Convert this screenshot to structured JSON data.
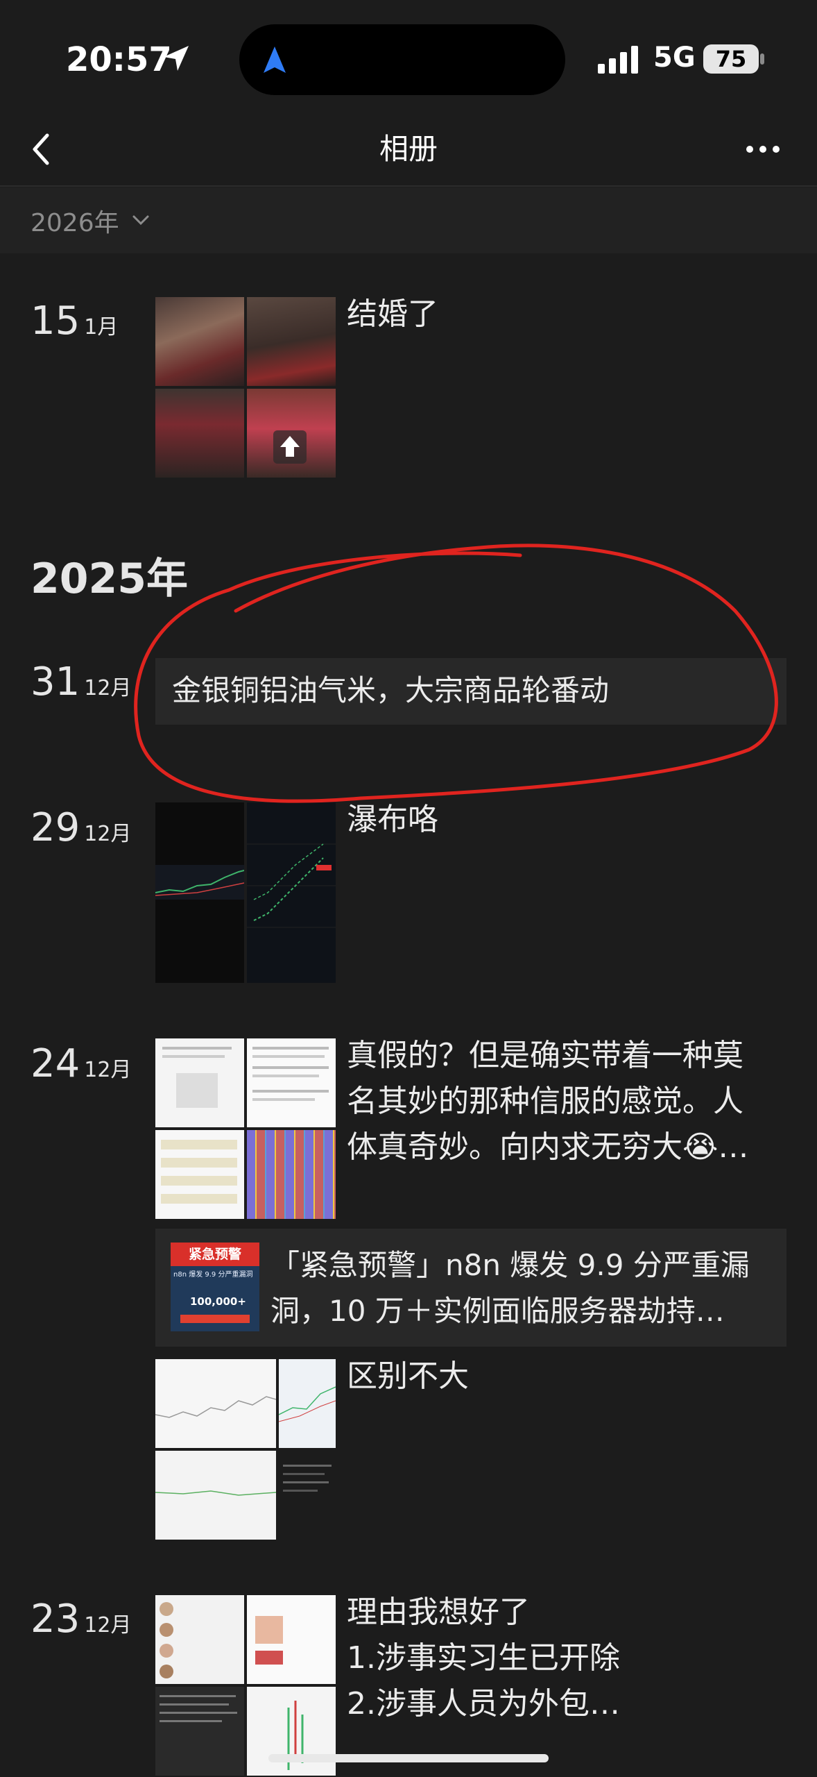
{
  "status_bar": {
    "time": "20:57",
    "network": "5G",
    "battery": "75"
  },
  "nav": {
    "title": "相册"
  },
  "year_filter": {
    "label": "2026年"
  },
  "entries_2026": [
    {
      "day": "15",
      "month": "1月",
      "caption": "结婚了"
    }
  ],
  "year_heading": "2025年",
  "entries_2025": [
    {
      "day": "31",
      "month": "12月",
      "text": "金银铜铝油气米，大宗商品轮番动"
    },
    {
      "day": "29",
      "month": "12月",
      "caption": "瀑布咯"
    },
    {
      "day": "24",
      "month": "12月",
      "caption": "真假的？但是确实带着一种莫名其妙的那种信服的感觉。人体真奇妙。向内求无穷大😭…",
      "link_card": {
        "thumb_badge": "紧急预警",
        "thumb_sub": "n8n 爆发 9.9 分严重漏洞",
        "thumb_num": "100,000+",
        "title": "「紧急预警」n8n 爆发 9.9 分严重漏洞，10 万＋实例面临服务器劫持…"
      },
      "caption2": "区别不大"
    },
    {
      "day": "23",
      "month": "12月",
      "caption_lines": [
        "理由我想好了",
        "1.涉事实习生已开除",
        "2.涉事人员为外包…"
      ]
    }
  ],
  "colors": {
    "background": "#1c1c1c",
    "card": "#282828",
    "annotation_red": "#e0241f",
    "accent_blue": "#2f7cf6"
  }
}
